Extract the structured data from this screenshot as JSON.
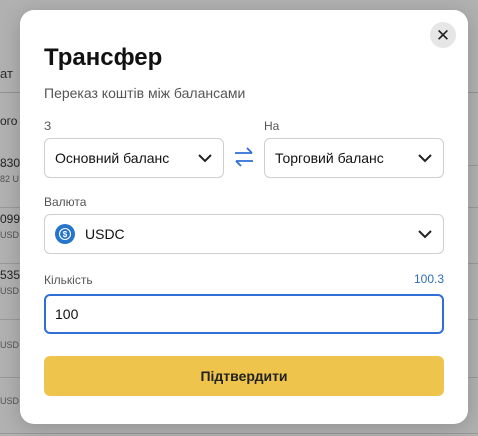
{
  "background": {
    "header": "ат",
    "rows": [
      {
        "line1": "ого",
        "line2": ""
      },
      {
        "line1": "830",
        "line2": "82 U"
      },
      {
        "line1": "099",
        "line2": "USD"
      },
      {
        "line1": "535",
        "line2": "USD"
      },
      {
        "line1": "",
        "line2": "USD"
      },
      {
        "line1": "",
        "line2": "USD"
      }
    ]
  },
  "modal": {
    "title": "Трансфер",
    "subtitle": "Переказ коштів між балансами",
    "close_icon": "close-icon",
    "from": {
      "label": "З",
      "value": "Основний баланс"
    },
    "to": {
      "label": "На",
      "value": "Торговий баланс"
    },
    "swap_icon": "swap-arrows-icon",
    "currency": {
      "label": "Валюта",
      "value": "USDC",
      "icon": "usdc-coin-icon"
    },
    "amount": {
      "label": "Кількість",
      "max": "100.3",
      "value": "100"
    },
    "confirm_label": "Підтвердити"
  },
  "colors": {
    "accent_button": "#efc44c",
    "focus_border": "#2f6fd6",
    "link": "#2f6fb8",
    "coin": "#2775ca"
  }
}
